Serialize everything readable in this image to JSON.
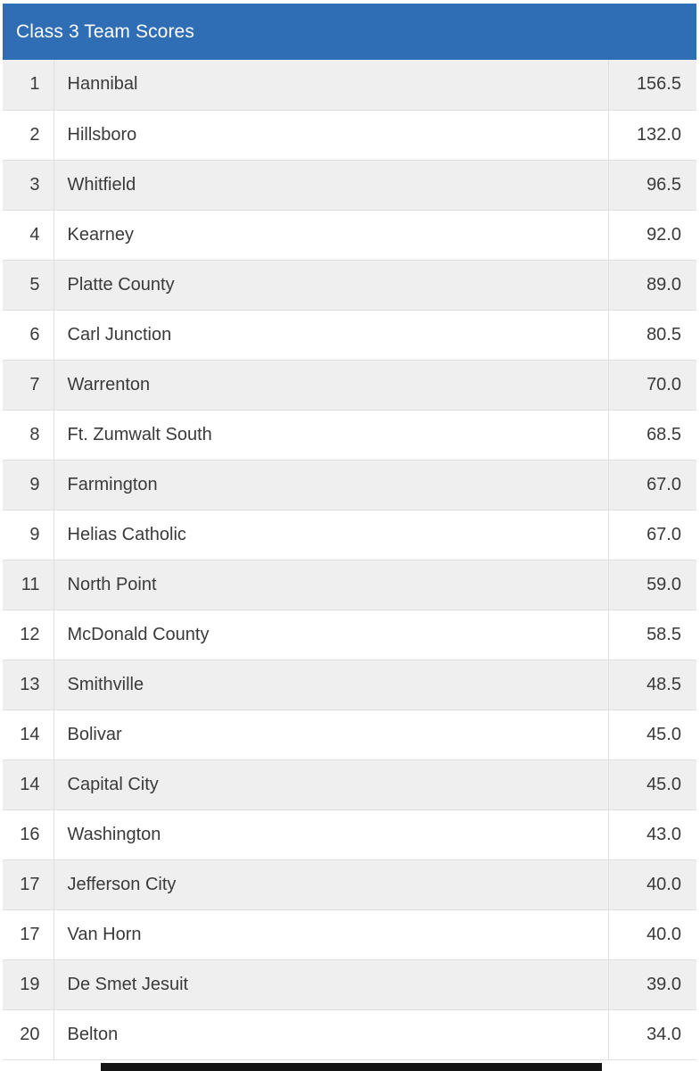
{
  "table": {
    "title": "Class 3 Team Scores",
    "header_bg": "#2f6eb5",
    "header_text_color": "#ffffff",
    "stripe_color": "#efefef",
    "columns": [
      "rank",
      "team",
      "score"
    ],
    "rows": [
      {
        "rank": "1",
        "team": "Hannibal",
        "score": "156.5"
      },
      {
        "rank": "2",
        "team": "Hillsboro",
        "score": "132.0"
      },
      {
        "rank": "3",
        "team": "Whitfield",
        "score": "96.5"
      },
      {
        "rank": "4",
        "team": "Kearney",
        "score": "92.0"
      },
      {
        "rank": "5",
        "team": "Platte County",
        "score": "89.0"
      },
      {
        "rank": "6",
        "team": "Carl Junction",
        "score": "80.5"
      },
      {
        "rank": "7",
        "team": "Warrenton",
        "score": "70.0"
      },
      {
        "rank": "8",
        "team": "Ft. Zumwalt South",
        "score": "68.5"
      },
      {
        "rank": "9",
        "team": "Farmington",
        "score": "67.0"
      },
      {
        "rank": "9",
        "team": "Helias Catholic",
        "score": "67.0"
      },
      {
        "rank": "11",
        "team": "North Point",
        "score": "59.0"
      },
      {
        "rank": "12",
        "team": "McDonald County",
        "score": "58.5"
      },
      {
        "rank": "13",
        "team": "Smithville",
        "score": "48.5"
      },
      {
        "rank": "14",
        "team": "Bolivar",
        "score": "45.0"
      },
      {
        "rank": "14",
        "team": "Capital City",
        "score": "45.0"
      },
      {
        "rank": "16",
        "team": "Washington",
        "score": "43.0"
      },
      {
        "rank": "17",
        "team": "Jefferson City",
        "score": "40.0"
      },
      {
        "rank": "17",
        "team": "Van Horn",
        "score": "40.0"
      },
      {
        "rank": "19",
        "team": "De Smet Jesuit",
        "score": "39.0"
      },
      {
        "rank": "20",
        "team": "Belton",
        "score": "34.0"
      }
    ]
  },
  "scrollbar": {
    "orientation": "horizontal",
    "thumb_color": "#141414",
    "track_color": "#ffffff"
  }
}
